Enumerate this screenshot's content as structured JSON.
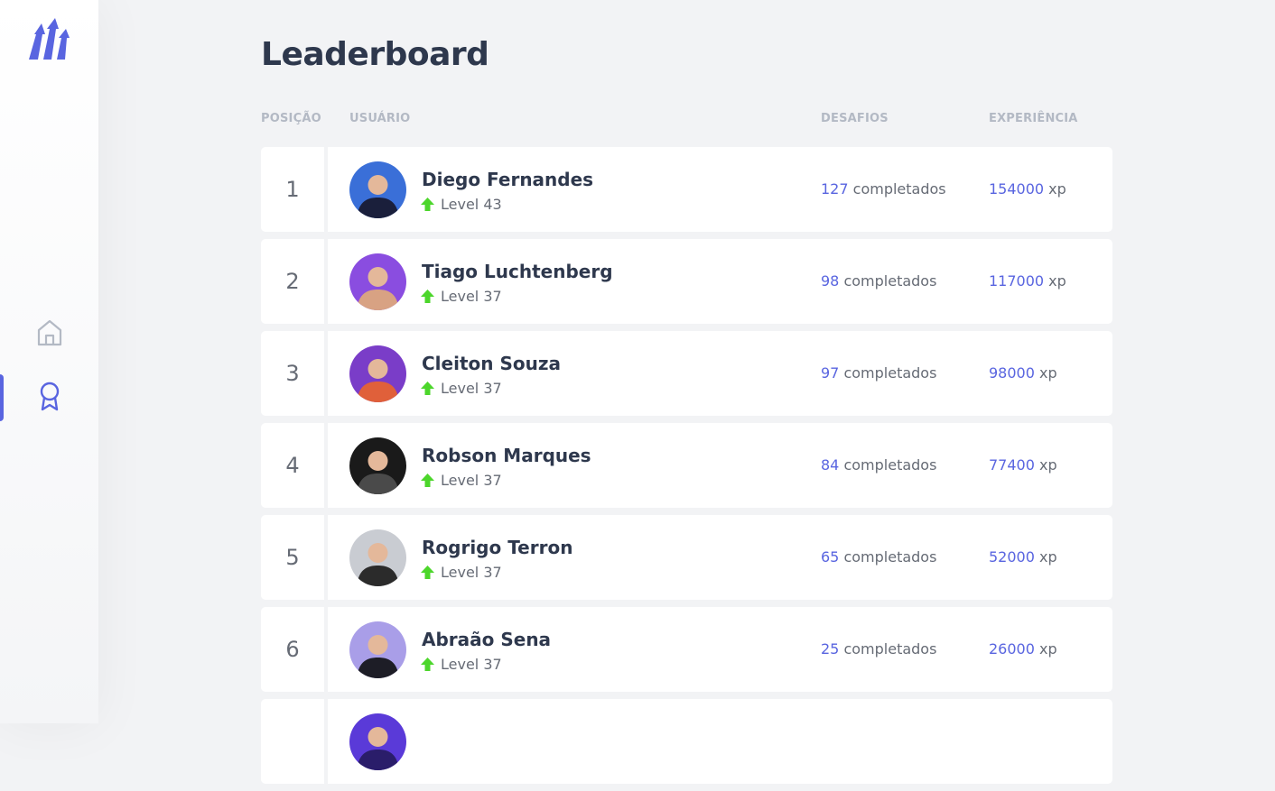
{
  "colors": {
    "accent": "#5965e0",
    "level_up": "#4cd62b",
    "text": "#2e384d",
    "muted": "#666b75",
    "header": "#b3b9c4",
    "background": "#f2f3f5"
  },
  "sidebar": {
    "logo_icon": "moveit-arrows-logo",
    "items": [
      {
        "icon": "home-icon",
        "active": false
      },
      {
        "icon": "award-icon",
        "active": true
      }
    ]
  },
  "page": {
    "title": "Leaderboard"
  },
  "table": {
    "headers": {
      "position": "POSIÇÃO",
      "user": "USUÁRIO",
      "challenges": "DESAFIOS",
      "experience": "EXPERIÊNCIA"
    },
    "challenges_suffix": "completados",
    "xp_suffix": "xp",
    "rows": [
      {
        "position": "1",
        "name": "Diego Fernandes",
        "level": "Level 43",
        "challenges": "127",
        "xp": "154000",
        "avatar_color_a": "#3a6fd8",
        "avatar_color_b": "#1a1f3b"
      },
      {
        "position": "2",
        "name": "Tiago Luchtenberg",
        "level": "Level 37",
        "challenges": "98",
        "xp": "117000",
        "avatar_color_a": "#8a4de0",
        "avatar_color_b": "#d8a283"
      },
      {
        "position": "3",
        "name": "Cleiton Souza",
        "level": "Level 37",
        "challenges": "97",
        "xp": "98000",
        "avatar_color_a": "#7a3dc8",
        "avatar_color_b": "#e0603a"
      },
      {
        "position": "4",
        "name": "Robson Marques",
        "level": "Level 37",
        "challenges": "84",
        "xp": "77400",
        "avatar_color_a": "#1a1a1a",
        "avatar_color_b": "#4a4a4a"
      },
      {
        "position": "5",
        "name": "Rogrigo Terron",
        "level": "Level 37",
        "challenges": "65",
        "xp": "52000",
        "avatar_color_a": "#c9ccd2",
        "avatar_color_b": "#2b2b2b"
      },
      {
        "position": "6",
        "name": "Abraão Sena",
        "level": "Level 37",
        "challenges": "25",
        "xp": "26000",
        "avatar_color_a": "#a99ee8",
        "avatar_color_b": "#1d1d26"
      },
      {
        "position": "",
        "name": "",
        "level": "",
        "challenges": "",
        "xp": "",
        "avatar_color_a": "#5a3ad8",
        "avatar_color_b": "#2a1d6a"
      }
    ]
  }
}
